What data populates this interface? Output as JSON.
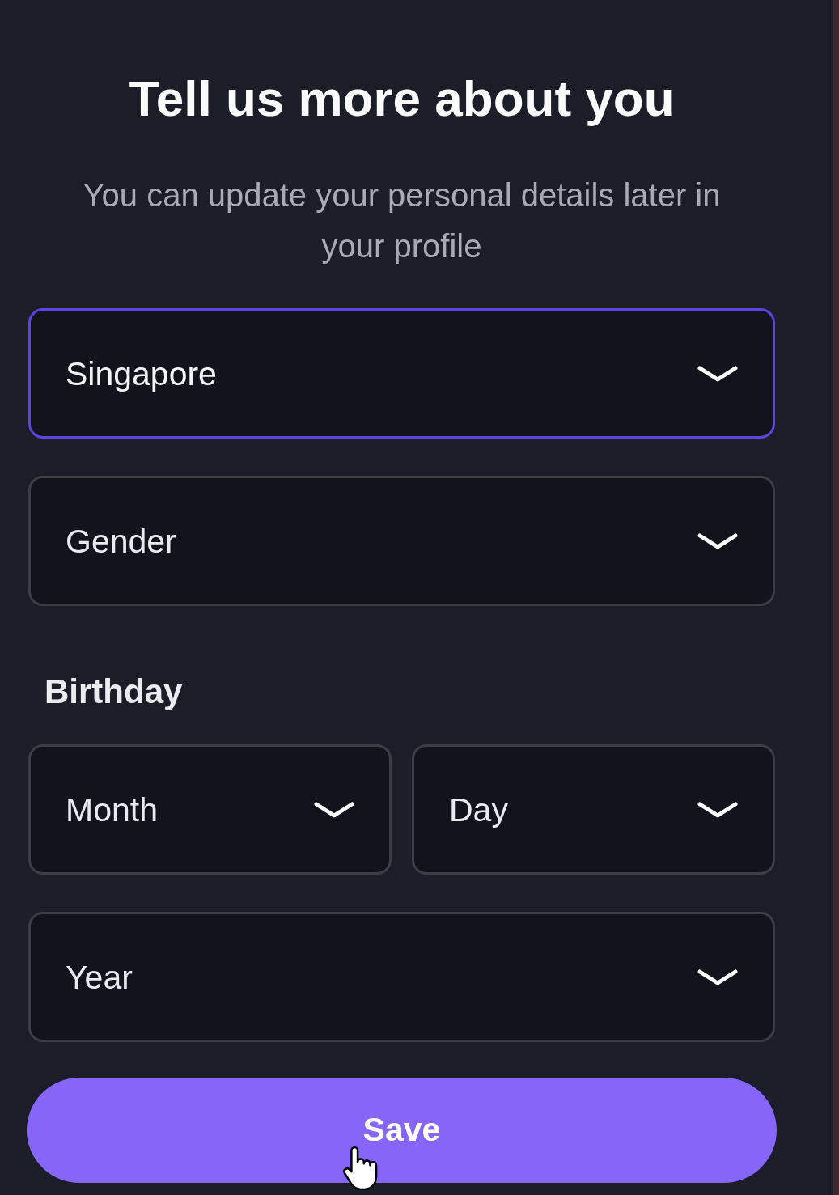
{
  "heading": "Tell us more about you",
  "subtitle": "You can update your personal details later in your profile",
  "fields": [
    {
      "value": "Singapore",
      "focused": true
    },
    {
      "placeholder": "Gender",
      "focused": false
    }
  ],
  "birthday": {
    "label": "Birthday",
    "rows": [
      {
        "fields": [
          {
            "placeholder": "Month",
            "focused": false
          },
          {
            "placeholder": "Day",
            "focused": false
          }
        ]
      },
      {
        "fields": [
          {
            "placeholder": "Year",
            "focused": false
          }
        ]
      }
    ]
  },
  "save_button": {
    "label": "Save"
  }
}
